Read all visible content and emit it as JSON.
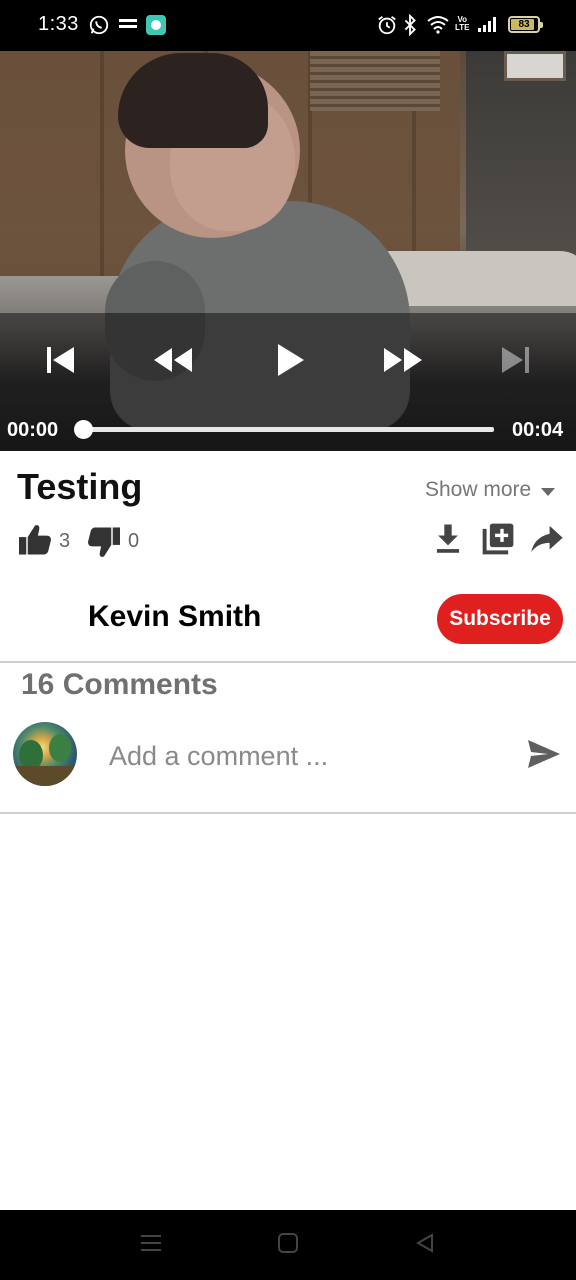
{
  "status_bar": {
    "time": "1:33",
    "network_label_top": "Vo",
    "network_label_bottom": "LTE",
    "battery": "83"
  },
  "player": {
    "current_time": "00:00",
    "duration": "00:04",
    "progress": 0.0,
    "icons": [
      "skip-previous-icon",
      "rewind-icon",
      "play-icon",
      "fast-forward-icon",
      "skip-next-icon"
    ]
  },
  "video": {
    "title": "Testing",
    "show_more": "Show more",
    "likes": "3",
    "dislikes": "0",
    "actions": [
      "download-icon",
      "add-to-playlist-icon",
      "share-icon"
    ]
  },
  "channel": {
    "name": "Kevin Smith",
    "subscribe_label": "Subscribe"
  },
  "comments": {
    "count_label": "16 Comments",
    "placeholder": "Add a comment ..."
  },
  "colors": {
    "subscribe": "#e01f1f",
    "muted_text": "#707070"
  }
}
